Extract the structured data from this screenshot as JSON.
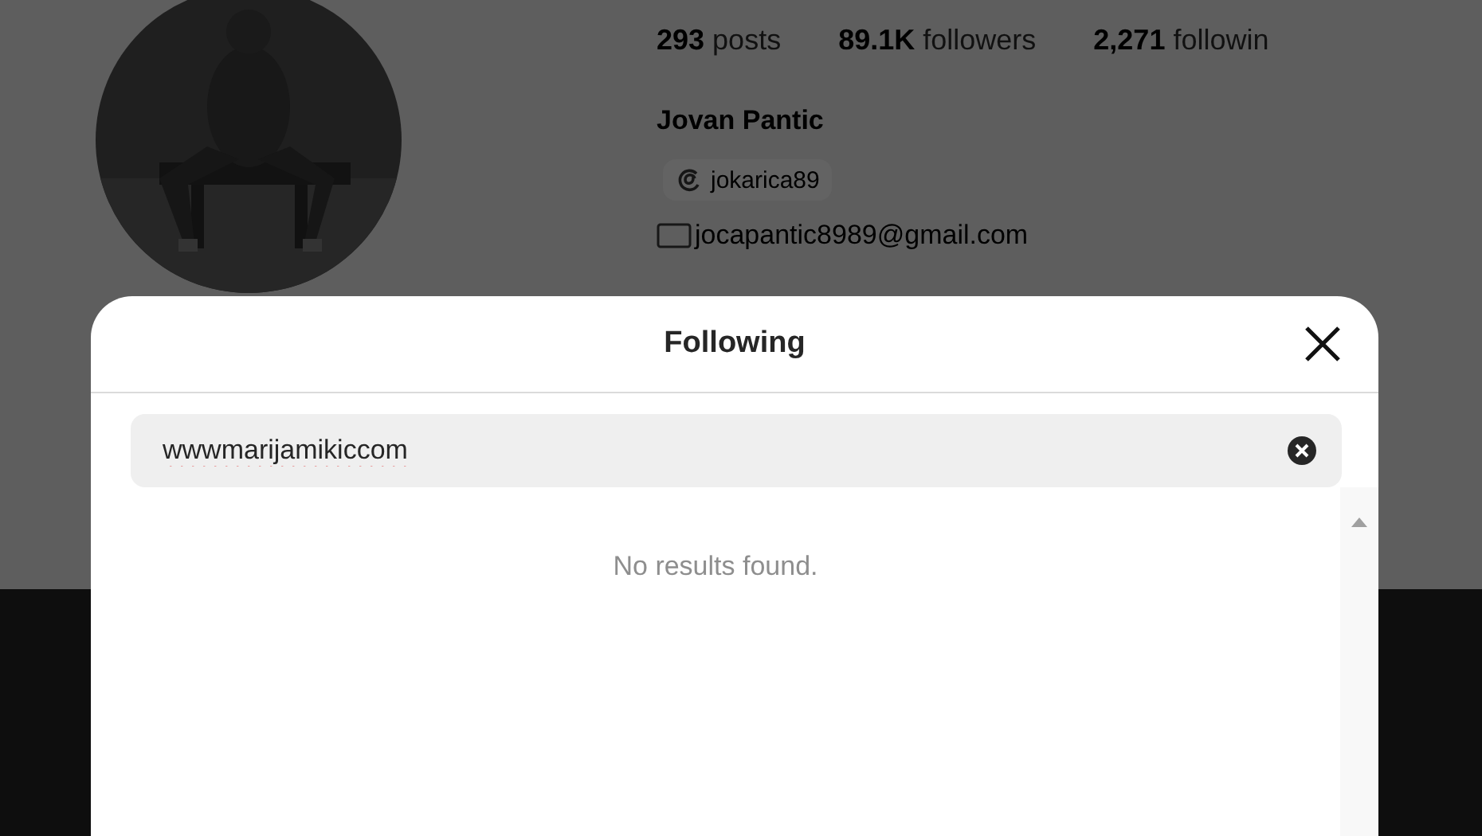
{
  "profile": {
    "stats": [
      {
        "count": "293",
        "label": "posts"
      },
      {
        "count": "89.1K",
        "label": "followers"
      },
      {
        "count": "2,271",
        "label": "followin"
      }
    ],
    "name": "Jovan Pantic",
    "threads_handle": "jokarica89",
    "email": "jocapantic8989@gmail.com"
  },
  "dialog": {
    "title": "Following",
    "search": {
      "value": "wwwmarijamikiccom"
    },
    "message": "No results found."
  }
}
